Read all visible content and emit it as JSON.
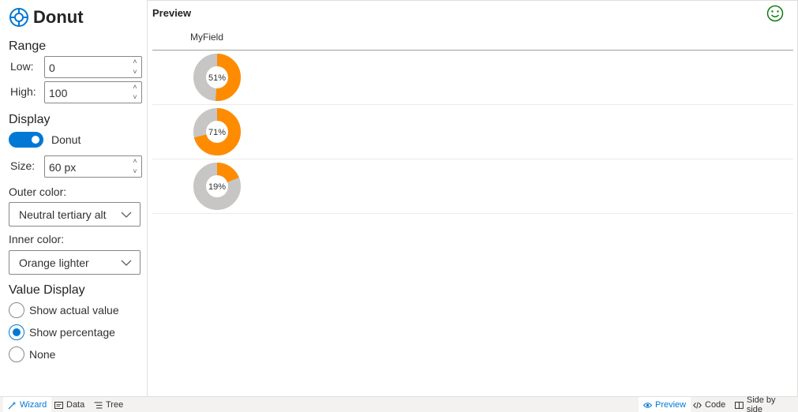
{
  "app": {
    "title": "Donut"
  },
  "range": {
    "heading": "Range",
    "low_label": "Low:",
    "low_value": "0",
    "high_label": "High:",
    "high_value": "100"
  },
  "display": {
    "heading": "Display",
    "toggle_label": "Donut",
    "toggle_on": true,
    "size_label": "Size:",
    "size_value": "60 px",
    "outer_color_label": "Outer color:",
    "outer_color_value": "Neutral tertiary alt",
    "inner_color_label": "Inner color:",
    "inner_color_value": "Orange lighter"
  },
  "value_display": {
    "heading": "Value Display",
    "options": [
      "Show actual value",
      "Show percentage",
      "None"
    ],
    "selected": "Show percentage"
  },
  "preview": {
    "title": "Preview",
    "column_header": "MyField",
    "rows": [
      {
        "label": "51%",
        "value": 0.51
      },
      {
        "label": "71%",
        "value": 0.71
      },
      {
        "label": "19%",
        "value": 0.19
      }
    ]
  },
  "colors": {
    "accent": "#0078d4",
    "donut_fill": "#ff8c00",
    "donut_track": "#c8c6c4",
    "smiley": "#107c10"
  },
  "bottom_left_tabs": [
    "Wizard",
    "Data",
    "Tree"
  ],
  "bottom_right_tabs": [
    "Preview",
    "Code",
    "Side by side"
  ]
}
